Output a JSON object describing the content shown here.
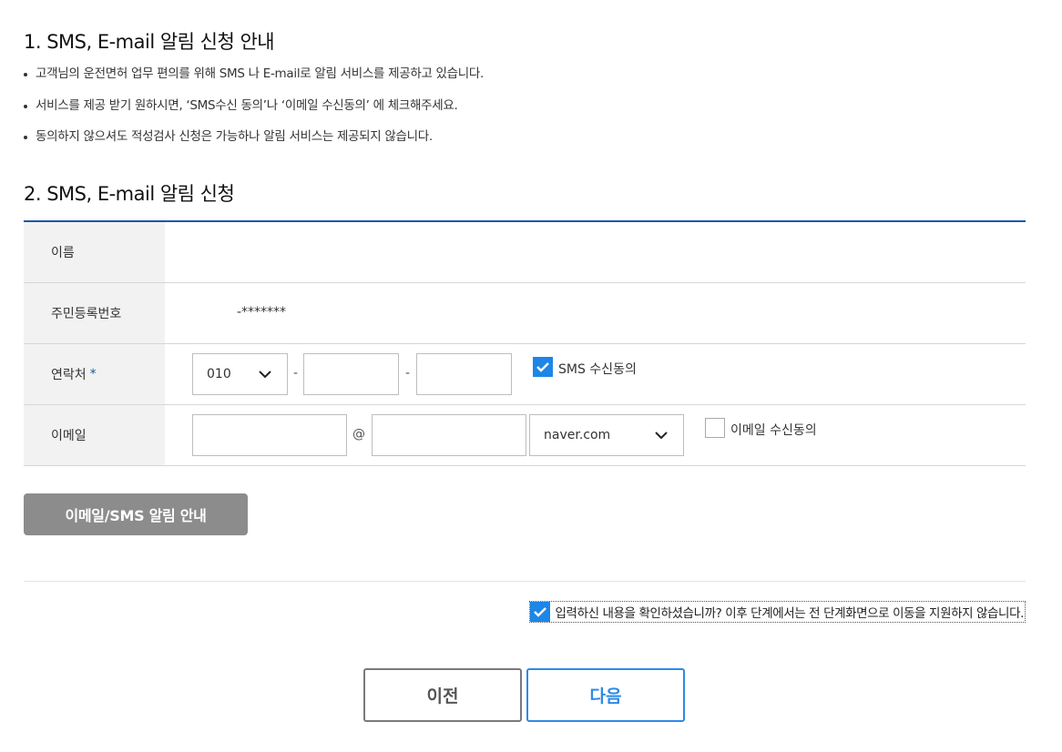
{
  "section1": {
    "title": "1. SMS, E-mail 알림 신청 안내",
    "bullets": [
      "고객님의 운전면허 업무 편의를 위해 SMS 나 E-mail로 알림 서비스를 제공하고 있습니다.",
      "서비스를 제공 받기 원하시면, ‘SMS수신 동의’나 ‘이메일 수신동의’ 에 체크해주세요.",
      "동의하지 않으셔도 적성검사 신청은 가능하나 알림 서비스는 제공되지 않습니다."
    ]
  },
  "section2": {
    "title": "2. SMS, E-mail 알림 신청",
    "rows": {
      "name_label": "이름",
      "name_value": "",
      "rrn_label": "주민등록번호",
      "rrn_value": "-*******",
      "phone_label": "연락처",
      "phone_required": "*",
      "phone_prefix": "010",
      "phone_sep": "-",
      "sms_consent_label": "SMS 수신동의",
      "sms_consent_checked": true,
      "email_label": "이메일",
      "email_at": "@",
      "email_domain": "naver.com",
      "email_consent_label": "이메일 수신동의",
      "email_consent_checked": false
    }
  },
  "guide_button": "이메일/SMS 알림 안내",
  "confirm": {
    "checked": true,
    "text": "입력하신 내용을 확인하셨습니까? 이후 단계에서는 전 단계화면으로 이동을 지원하지 않습니다."
  },
  "nav": {
    "prev": "이전",
    "next": "다음"
  },
  "colors": {
    "accent": "#1d58a6",
    "check": "#1d86e6",
    "next": "#2f8ae6",
    "guide": "#8c8c8c"
  }
}
